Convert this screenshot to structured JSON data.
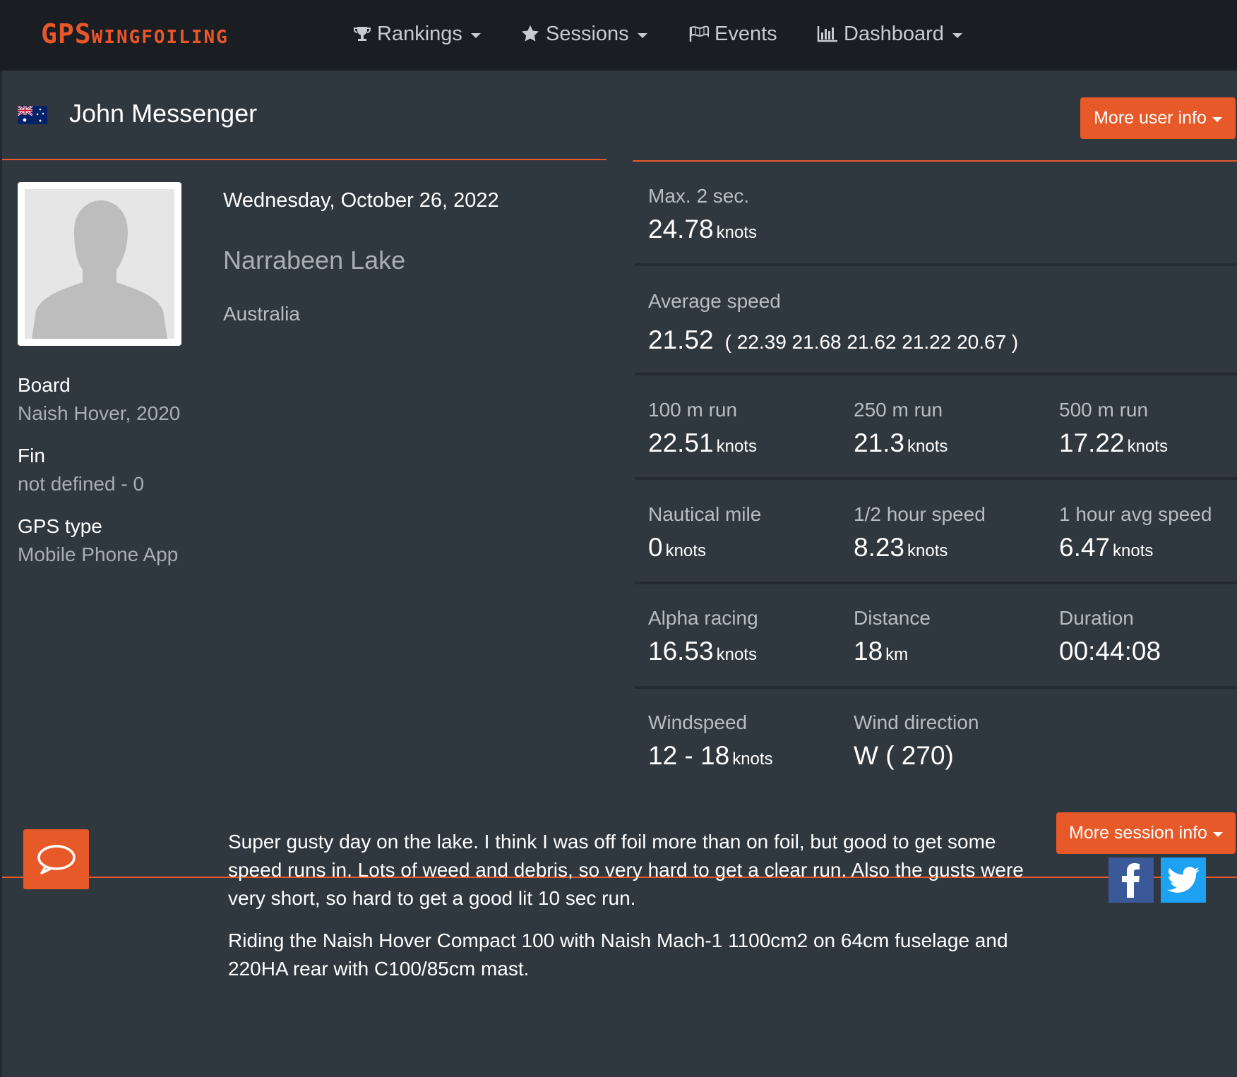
{
  "nav": {
    "logo_big": "GPS",
    "logo_small": "WINGFOILING",
    "items": [
      {
        "label": "Rankings",
        "icon": "trophy-icon"
      },
      {
        "label": "Sessions",
        "icon": "star-icon"
      },
      {
        "label": "Events",
        "icon": "flag-icon"
      },
      {
        "label": "Dashboard",
        "icon": "bar-chart-icon"
      }
    ]
  },
  "user": {
    "name": "John Messenger",
    "country_flag": "australia-flag-icon",
    "more_info_label": "More user info"
  },
  "session": {
    "date": "Wednesday, October 26, 2022",
    "spot": "Narrabeen Lake",
    "country": "Australia",
    "more_info_label": "More session info"
  },
  "equipment": {
    "board_label": "Board",
    "board_value": "Naish Hover, 2020",
    "fin_label": "Fin",
    "fin_value": "not defined - 0",
    "gps_label": "GPS type",
    "gps_value": "Mobile Phone App"
  },
  "stats": {
    "max2": {
      "label": "Max. 2 sec.",
      "value": "24.78",
      "unit": "knots"
    },
    "avg": {
      "label": "Average speed",
      "value": "21.52",
      "runs": "( 22.39 21.68 21.62 21.22 20.67 )"
    },
    "run100": {
      "label": "100 m run",
      "value": "22.51",
      "unit": "knots"
    },
    "run250": {
      "label": "250 m run",
      "value": "21.3",
      "unit": "knots"
    },
    "run500": {
      "label": "500 m run",
      "value": "17.22",
      "unit": "knots"
    },
    "nautical": {
      "label": "Nautical mile",
      "value": "0",
      "unit": "knots"
    },
    "halfhour": {
      "label": "1/2 hour speed",
      "value": "8.23",
      "unit": "knots"
    },
    "hour": {
      "label": "1 hour avg speed",
      "value": "6.47",
      "unit": "knots"
    },
    "alpha": {
      "label": "Alpha racing",
      "value": "16.53",
      "unit": "knots"
    },
    "distance": {
      "label": "Distance",
      "value": "18",
      "unit": "km"
    },
    "duration": {
      "label": "Duration",
      "value": "00:44:08"
    },
    "windspeed": {
      "label": "Windspeed",
      "value": "12 - 18",
      "unit": "knots"
    },
    "winddir": {
      "label": "Wind direction",
      "value": "W ( 270)"
    }
  },
  "comment": {
    "icon": "comment-icon",
    "paragraph1": "Super  gusty day on the lake. I  think I was off foil more than on foil, but good to get some speed runs in. Lots of weed and debris, so very hard to get a clear run. Also the gusts were very short, so hard to get a good lit 10 sec run.",
    "paragraph2": "Riding the Naish Hover Compact 100 with Naish Mach-1 1100cm2 on 64cm fuselage and 220HA rear with C100/85cm mast."
  },
  "colors": {
    "accent": "#e8592a",
    "navbar_bg": "#1a1e23",
    "panel_bg": "#2f373f",
    "facebook": "#3b5998",
    "twitter": "#1da1f2"
  }
}
